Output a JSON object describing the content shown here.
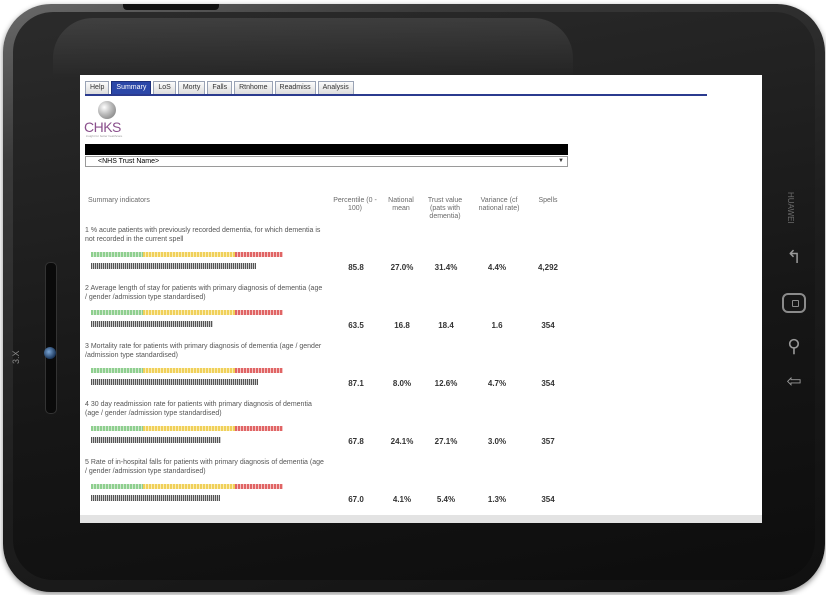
{
  "device": {
    "side_label": "3.X",
    "brand": "HUAWEI"
  },
  "tabs": [
    {
      "label": "Help",
      "active": false
    },
    {
      "label": "Summary",
      "active": true
    },
    {
      "label": "LoS",
      "active": false
    },
    {
      "label": "Morty",
      "active": false
    },
    {
      "label": "Falls",
      "active": false
    },
    {
      "label": "Rtnhome",
      "active": false
    },
    {
      "label": "Readmiss",
      "active": false
    },
    {
      "label": "Analysis",
      "active": false
    }
  ],
  "logo": {
    "text": "CHKS",
    "sub": "insight for better healthcare"
  },
  "trust_select": {
    "value": "<NHS Trust Name>"
  },
  "table": {
    "headers": {
      "indicator": "Summary indicators",
      "percentile": "Percentile (0 - 100)",
      "national_mean": "National mean",
      "trust_value": "Trust value (pats with dementia)",
      "variance": "Variance (cf national rate)",
      "spells": "Spells"
    },
    "rows": [
      {
        "title": "1 % acute patients with previously recorded dementia, for which dementia is not recorded in the current spell",
        "percentile": "85.8",
        "national_mean": "27.0%",
        "trust_value": "31.4%",
        "variance": "4.4%",
        "spells": "4,292",
        "percentile_fraction": 0.858
      },
      {
        "title": "2 Average length of stay for patients with primary diagnosis of dementia (age / gender /admission type standardised)",
        "percentile": "63.5",
        "national_mean": "16.8",
        "trust_value": "18.4",
        "variance": "1.6",
        "spells": "354",
        "percentile_fraction": 0.635
      },
      {
        "title": "3 Mortality rate for patients with primary diagnosis of dementia (age / gender /admission type standardised)",
        "percentile": "87.1",
        "national_mean": "8.0%",
        "trust_value": "12.6%",
        "variance": "4.7%",
        "spells": "354",
        "percentile_fraction": 0.871
      },
      {
        "title": "4 30 day readmission rate for patients with primary diagnosis of dementia (age / gender /admission type standardised)",
        "percentile": "67.8",
        "national_mean": "24.1%",
        "trust_value": "27.1%",
        "variance": "3.0%",
        "spells": "357",
        "percentile_fraction": 0.678
      },
      {
        "title": "5 Rate of in-hospital falls for patients with primary diagnosis of dementia (age / gender /admission type standardised)",
        "percentile": "67.0",
        "national_mean": "4.1%",
        "trust_value": "5.4%",
        "variance": "1.3%",
        "spells": "354",
        "percentile_fraction": 0.67
      }
    ]
  },
  "colors": {
    "active_tab": "#2b47a8",
    "logo": "#8a4f8c",
    "rag_green": "#8fcf8f",
    "rag_amber": "#f0d05a",
    "rag_red": "#e06565"
  }
}
